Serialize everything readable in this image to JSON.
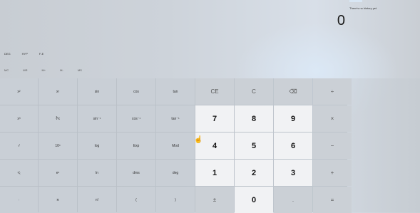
{
  "history": {
    "empty_text": "There's no history yet"
  },
  "display": {
    "value": "0"
  },
  "mode_row": [
    "DEG",
    "HYP",
    "F-E"
  ],
  "memory_row": [
    "MC",
    "MR",
    "M+",
    "M-",
    "MS"
  ],
  "keypad": {
    "rows": [
      [
        {
          "label": "x²",
          "kind": "fn"
        },
        {
          "label": "xʸ",
          "kind": "fn"
        },
        {
          "label": "sin",
          "kind": "fn"
        },
        {
          "label": "cos",
          "kind": "fn"
        },
        {
          "label": "tan",
          "kind": "fn"
        },
        {
          "label": "CE",
          "kind": "op"
        },
        {
          "label": "C",
          "kind": "op"
        },
        {
          "label": "⌫",
          "kind": "op"
        },
        {
          "label": "÷",
          "kind": "op"
        }
      ],
      [
        {
          "label": "x³",
          "kind": "fn"
        },
        {
          "label": "∛x",
          "kind": "fn"
        },
        {
          "label": "sin⁻¹",
          "kind": "fn"
        },
        {
          "label": "cos⁻¹",
          "kind": "fn"
        },
        {
          "label": "tan⁻¹",
          "kind": "fn"
        },
        {
          "label": "7",
          "kind": "num"
        },
        {
          "label": "8",
          "kind": "num"
        },
        {
          "label": "9",
          "kind": "num"
        },
        {
          "label": "×",
          "kind": "op"
        }
      ],
      [
        {
          "label": "√",
          "kind": "fn"
        },
        {
          "label": "10ˣ",
          "kind": "fn"
        },
        {
          "label": "log",
          "kind": "fn"
        },
        {
          "label": "Exp",
          "kind": "fn"
        },
        {
          "label": "Mod",
          "kind": "fn"
        },
        {
          "label": "4",
          "kind": "num"
        },
        {
          "label": "5",
          "kind": "num"
        },
        {
          "label": "6",
          "kind": "num"
        },
        {
          "label": "−",
          "kind": "op"
        }
      ],
      [
        {
          "label": "¹⁄ₓ",
          "kind": "fn"
        },
        {
          "label": "eˣ",
          "kind": "fn"
        },
        {
          "label": "ln",
          "kind": "fn"
        },
        {
          "label": "dms",
          "kind": "fn"
        },
        {
          "label": "deg",
          "kind": "fn"
        },
        {
          "label": "1",
          "kind": "num"
        },
        {
          "label": "2",
          "kind": "num"
        },
        {
          "label": "3",
          "kind": "num"
        },
        {
          "label": "+",
          "kind": "op"
        }
      ],
      [
        {
          "label": "↑",
          "kind": "fn-dim"
        },
        {
          "label": "π",
          "kind": "fn"
        },
        {
          "label": "n!",
          "kind": "fn"
        },
        {
          "label": "(",
          "kind": "fn"
        },
        {
          "label": ")",
          "kind": "fn"
        },
        {
          "label": "±",
          "kind": "op"
        },
        {
          "label": "0",
          "kind": "num"
        },
        {
          "label": ".",
          "kind": "op"
        },
        {
          "label": "=",
          "kind": "op"
        }
      ]
    ]
  }
}
